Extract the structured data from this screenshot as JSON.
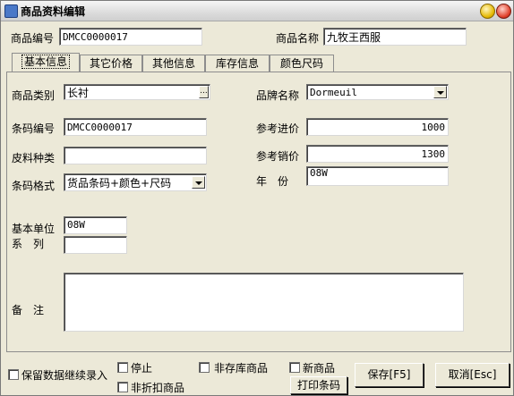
{
  "window": {
    "title": "商品资料编辑"
  },
  "header": {
    "code_label": "商品编号",
    "code_value": "DMCC0000017",
    "name_label": "商品名称",
    "name_value": "九牧王西服"
  },
  "tabs": [
    {
      "label": "基本信息",
      "active": true
    },
    {
      "label": "其它价格",
      "active": false
    },
    {
      "label": "其他信息",
      "active": false
    },
    {
      "label": "库存信息",
      "active": false
    },
    {
      "label": "颜色尺码",
      "active": false
    }
  ],
  "form": {
    "category_label": "商品类别",
    "category_value": "长衬",
    "category_browse": "...",
    "brand_label": "品牌名称",
    "brand_value": "Dormeuil",
    "barcode_label": "条码编号",
    "barcode_value": "DMCC0000017",
    "cost_label": "参考进价",
    "cost_value": "1000",
    "fabric_label": "皮料种类",
    "fabric_value": "",
    "sale_label": "参考销价",
    "sale_value": "1300",
    "barcode_format_label": "条码格式",
    "barcode_format_value": "货品条码+颜色+尺码",
    "year_label": "年　份",
    "year_value": "08W",
    "unit_label": "基本单位",
    "unit_value": "08W",
    "series_label": "系　列",
    "series_value": "",
    "remark_label": "备　注",
    "remark_value": ""
  },
  "footer": {
    "keep_data_label": "保留数据继续录入",
    "stop_label": "停止",
    "non_stock_label": "非存库商品",
    "new_product_label": "新商品",
    "non_discount_label": "非折扣商品",
    "print_barcode_label": "打印条码",
    "save_label": "保存[F5]",
    "cancel_label": "取消[Esc]"
  }
}
